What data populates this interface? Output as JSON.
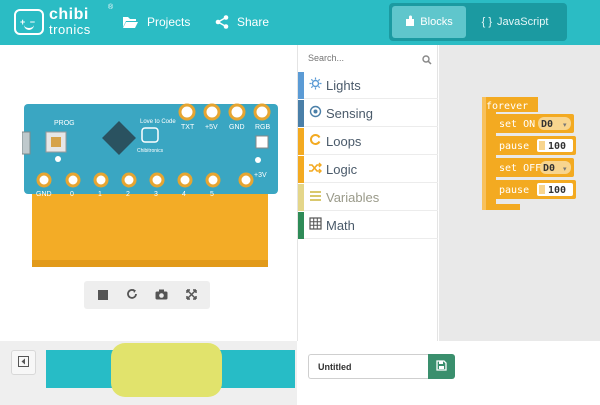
{
  "brand": {
    "line1": "chibi",
    "line2": "tronics",
    "reg": "®"
  },
  "nav": {
    "projects": "Projects",
    "share": "Share"
  },
  "modes": {
    "blocks": "Blocks",
    "javascript": "JavaScript",
    "active": "blocks"
  },
  "board": {
    "top_pins": [
      "TXT",
      "+5V",
      "GND",
      "RGB"
    ],
    "bottom_pins": [
      "GND",
      "0",
      "1",
      "2",
      "3",
      "4",
      "5",
      "+3V"
    ],
    "labels": [
      "PROG",
      "Love to Code",
      "Chibitronics"
    ]
  },
  "simulator_controls": {
    "stop": "stop-icon",
    "restart": "refresh-icon",
    "screenshot": "camera-icon",
    "fullscreen": "expand-icon"
  },
  "search": {
    "placeholder": "Search..."
  },
  "categories": [
    {
      "label": "Lights",
      "color": "#5b9bd5",
      "icon": "sun-icon"
    },
    {
      "label": "Sensing",
      "color": "#4a7fa8",
      "icon": "target-icon"
    },
    {
      "label": "Loops",
      "color": "#f3aa21",
      "icon": "loop-icon"
    },
    {
      "label": "Logic",
      "color": "#f3aa21",
      "icon": "shuffle-icon"
    },
    {
      "label": "Variables",
      "color": "#e4d68a",
      "icon": "list-icon"
    },
    {
      "label": "Math",
      "color": "#2e8b57",
      "icon": "grid-icon"
    }
  ],
  "program": {
    "container": "forever",
    "statements": [
      {
        "keyword": "set ON",
        "value": "D0"
      },
      {
        "keyword": "pause",
        "value": "100"
      },
      {
        "keyword": "set OFF",
        "value": "D0"
      },
      {
        "keyword": "pause",
        "value": "100"
      }
    ],
    "block_color": "#f3aa21",
    "block_color_light": "#f8c15c"
  },
  "project": {
    "name": "Untitled"
  },
  "colors": {
    "header": "#2bbcc4",
    "band": "#27bcc6",
    "face": "#e1e36c",
    "save": "#3a8f6d"
  }
}
